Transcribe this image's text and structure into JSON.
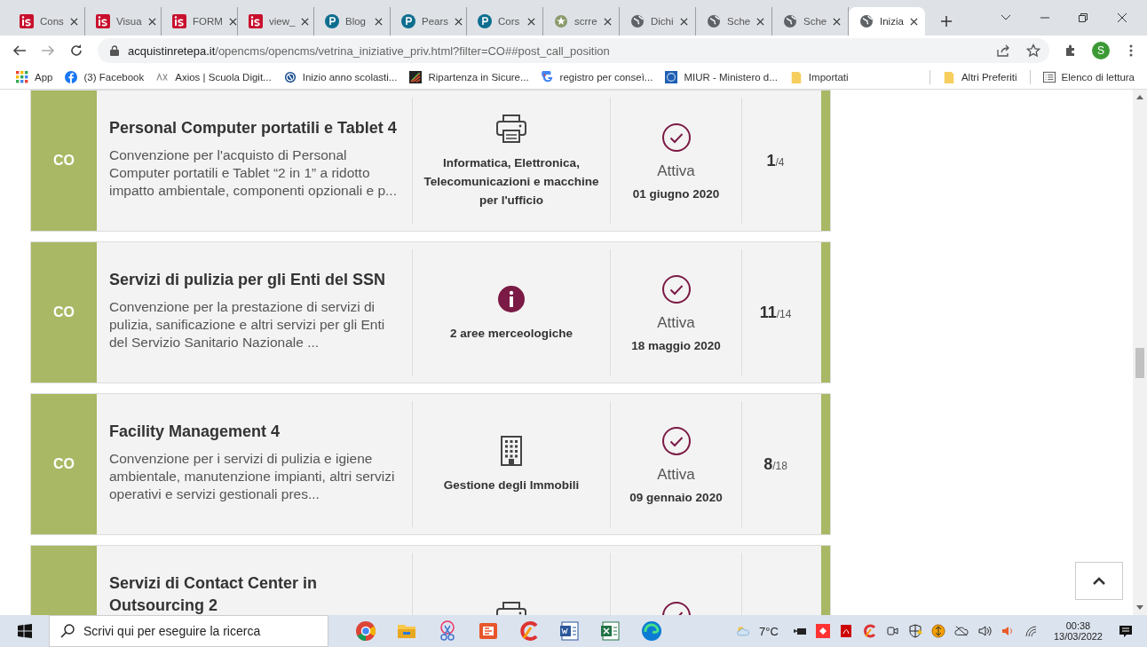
{
  "tabs": [
    {
      "title": "Cons",
      "kind": "is",
      "selected": false
    },
    {
      "title": "Visua",
      "kind": "is",
      "selected": false
    },
    {
      "title": "FORM",
      "kind": "is",
      "selected": false
    },
    {
      "title": "view_",
      "kind": "is",
      "selected": false
    },
    {
      "title": "Blog",
      "kind": "p",
      "selected": false
    },
    {
      "title": "Pears",
      "kind": "p",
      "selected": false
    },
    {
      "title": "Cors",
      "kind": "p",
      "selected": false
    },
    {
      "title": "scrre",
      "kind": "emblem",
      "selected": false
    },
    {
      "title": "Dichi",
      "kind": "globe",
      "selected": false
    },
    {
      "title": "Sche",
      "kind": "globe",
      "selected": false
    },
    {
      "title": "Sche",
      "kind": "globe",
      "selected": false
    },
    {
      "title": "Inizia",
      "kind": "globe",
      "selected": true
    }
  ],
  "address": {
    "domain": "acquistinretepa.it",
    "path": "/opencms/opencms/vetrina_iniziative_priv.html?filter=CO##post_call_position"
  },
  "profile_initial": "S",
  "bookmarks": [
    {
      "label": "App",
      "kind": "apps"
    },
    {
      "label": "(3) Facebook",
      "kind": "facebook"
    },
    {
      "label": "Axios | Scuola Digit...",
      "kind": "axios"
    },
    {
      "label": "Inizio anno scolasti...",
      "kind": "circle"
    },
    {
      "label": "Ripartenza in Sicure...",
      "kind": "square"
    },
    {
      "label": "registro per conseì...",
      "kind": "g"
    },
    {
      "label": "MIUR - Ministero d...",
      "kind": "emblem"
    },
    {
      "label": "Importati",
      "kind": "folder"
    }
  ],
  "bookmarks_right": [
    {
      "label": "Altri Preferiti",
      "kind": "folder"
    },
    {
      "label": "Elenco di lettura",
      "kind": "list"
    }
  ],
  "cards": [
    {
      "badge": "CO",
      "title": "Personal Computer portatili e Tablet 4",
      "description": "Convenzione per l'acquisto di Personal Computer portatili e Tablet “2 in 1” a ridotto impatto ambientale, componenti opzionali e p...",
      "kind": "printer",
      "category": "Informatica, Elettronica, Telecomunicazioni e macchine per l'ufficio",
      "status": "Attiva",
      "date": "01 giugno 2020",
      "count": "1",
      "total": "/4"
    },
    {
      "badge": "CO",
      "title": "Servizi di pulizia per gli Enti del SSN",
      "description": "Convenzione per la prestazione di servizi di pulizia, sanificazione e altri servizi per gli Enti del Servizio Sanitario Nazionale ...",
      "kind": "info",
      "category": "2 aree merceologiche",
      "status": "Attiva",
      "date": "18 maggio 2020",
      "count": "11",
      "total": "/14"
    },
    {
      "badge": "CO",
      "title": "Facility Management 4",
      "description": "Convenzione per i servizi di pulizia e igiene ambientale, manutenzione impianti, altri servizi operativi e servizi gestionali pres...",
      "kind": "building",
      "category": "Gestione degli Immobili",
      "status": "Attiva",
      "date": "09 gennaio 2020",
      "count": "8",
      "total": "/18"
    },
    {
      "title": "Servizi di Contact Center in Outsourcing 2",
      "kind": "printer"
    }
  ],
  "taskbar": {
    "search_placeholder": "Scrivi qui per eseguire la ricerca",
    "apps": [
      {
        "kind": "chrome"
      },
      {
        "kind": "explorer"
      },
      {
        "kind": "snip"
      },
      {
        "kind": "office"
      },
      {
        "kind": "ccleaner"
      },
      {
        "kind": "word"
      },
      {
        "kind": "excel"
      },
      {
        "kind": "edge"
      }
    ],
    "temperature": "7°C",
    "time": "00:38",
    "date": "13/03/2022"
  }
}
